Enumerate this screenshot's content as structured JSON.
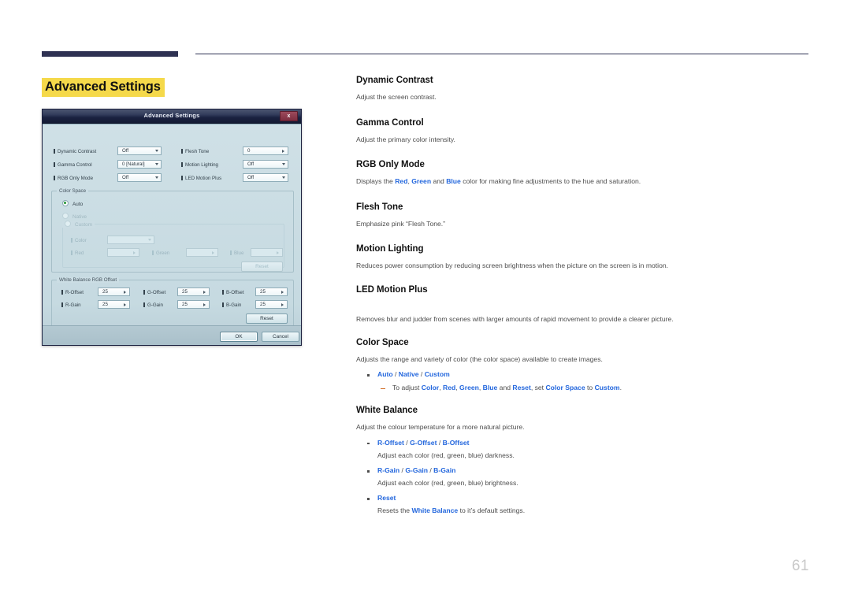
{
  "page": {
    "title": "Advanced Settings",
    "number": "61",
    "highlight_color": "#f5d94a",
    "rule_color": "#2e3152",
    "accent_blue": "#2266dd"
  },
  "dialog": {
    "title": "Advanced Settings",
    "close_label": "x",
    "fields": [
      {
        "label": "Dynamic Contrast",
        "value": "Off",
        "kind": "dropdown",
        "enabled": true
      },
      {
        "label": "Gamma Control",
        "value": "0 [Natural]",
        "kind": "dropdown",
        "enabled": true
      },
      {
        "label": "RGB Only Mode",
        "value": "Off",
        "kind": "dropdown",
        "enabled": true
      },
      {
        "label": "Flesh Tone",
        "value": "0",
        "kind": "spinner",
        "enabled": true
      },
      {
        "label": "Motion Lighting",
        "value": "Off",
        "kind": "dropdown",
        "enabled": true
      },
      {
        "label": "LED Motion Plus",
        "value": "Off",
        "kind": "dropdown",
        "enabled": true
      }
    ],
    "color_space": {
      "legend": "Color Space",
      "options": [
        {
          "label": "Auto",
          "selected": true
        },
        {
          "label": "Native",
          "selected": false
        },
        {
          "label": "Custom",
          "selected": false
        }
      ],
      "custom_legend": "Custom",
      "custom_fields": [
        {
          "label": "Color",
          "value": "",
          "kind": "dropdown"
        },
        {
          "label": "Red",
          "value": "",
          "kind": "spinner"
        },
        {
          "label": "Green",
          "value": "",
          "kind": "spinner"
        },
        {
          "label": "Blue",
          "value": "",
          "kind": "spinner"
        }
      ],
      "reset_label": "Reset"
    },
    "white_balance": {
      "legend": "White Balance RGB Offset",
      "fields": [
        {
          "label": "R-Offset",
          "value": "25"
        },
        {
          "label": "G-Offset",
          "value": "25"
        },
        {
          "label": "B-Offset",
          "value": "25"
        },
        {
          "label": "R-Gain",
          "value": "25"
        },
        {
          "label": "G-Gain",
          "value": "25"
        },
        {
          "label": "B-Gain",
          "value": "25"
        }
      ],
      "reset_label": "Reset"
    },
    "ok_label": "OK",
    "cancel_label": "Cancel"
  },
  "sections": {
    "dynamic_contrast": {
      "heading": "Dynamic Contrast",
      "body": "Adjust the screen contrast."
    },
    "gamma_control": {
      "heading": "Gamma Control",
      "body": "Adjust the primary color intensity."
    },
    "rgb_only_mode": {
      "heading": "RGB Only Mode",
      "body_1": "Displays the ",
      "red": "Red",
      "sep_1": ", ",
      "green": "Green",
      "sep_2": " and ",
      "blue": "Blue",
      "body_2": " color for making fine adjustments to the hue and saturation."
    },
    "flesh_tone": {
      "heading": "Flesh Tone",
      "body": "Emphasize pink “Flesh Tone.”"
    },
    "motion_lighting": {
      "heading": "Motion Lighting",
      "body": "Reduces power consumption by reducing screen brightness when the picture on the screen is in motion."
    },
    "led_motion_plus": {
      "heading": "LED Motion Plus",
      "body": "Removes blur and judder from scenes with larger amounts of rapid movement to provide a clearer picture."
    },
    "color_space": {
      "heading": "Color Space",
      "body": "Adjusts the range and variety of color (the color space) available to create images.",
      "bullet_auto": "Auto",
      "bullet_sep_1": " / ",
      "bullet_native": "Native",
      "bullet_sep_2": " / ",
      "bullet_custom": "Custom",
      "sub_pre": "To adjust ",
      "sub_color": "Color",
      "sub_s1": ", ",
      "sub_red": "Red",
      "sub_s2": ", ",
      "sub_green": "Green",
      "sub_s3": ", ",
      "sub_blue": "Blue",
      "sub_s4": " and ",
      "sub_reset": "Reset",
      "sub_mid": ", set ",
      "sub_cs": "Color Space",
      "sub_to": " to ",
      "sub_custom": "Custom",
      "sub_end": "."
    },
    "white_balance": {
      "heading": "White Balance",
      "body": "Adjust the colour temperature for a more natural picture.",
      "b_roffset": "R-Offset",
      "b_sep1": " / ",
      "b_goffset": "G-Offset",
      "b_sep2": " / ",
      "b_boffset": "B-Offset",
      "p_offset": "Adjust each color (red, green, blue) darkness.",
      "b_rgain": "R-Gain",
      "b_sep3": " / ",
      "b_ggain": "G-Gain",
      "b_sep4": " / ",
      "b_bgain": "B-Gain",
      "p_gain": "Adjust each color (red, green, blue) brightness.",
      "b_reset": "Reset",
      "p_reset_pre": "Resets the ",
      "p_reset_wb": "White Balance",
      "p_reset_post": " to it’s default settings."
    }
  }
}
